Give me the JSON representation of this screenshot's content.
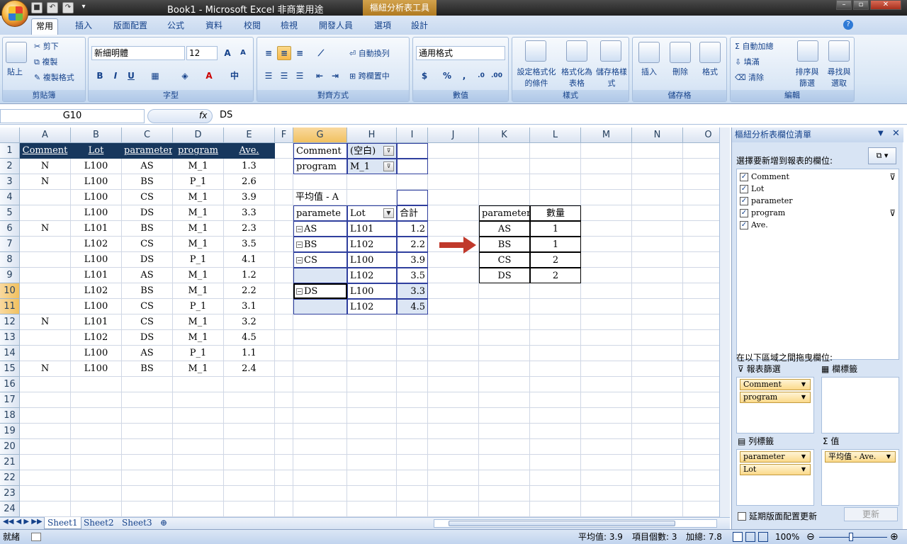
{
  "window": {
    "title": "Book1 - Microsoft Excel 非商業用途",
    "context_tab": "樞紐分析表工具"
  },
  "tabs": [
    "常用",
    "插入",
    "版面配置",
    "公式",
    "資料",
    "校閱",
    "檢視",
    "開發人員",
    "選項",
    "設計"
  ],
  "ribbon": {
    "clipboard": {
      "paste": "貼上",
      "cut": "剪下",
      "copy": "複製",
      "format_painter": "複製格式",
      "label": "剪貼簿"
    },
    "font": {
      "name": "新細明體",
      "size": "12",
      "label": "字型"
    },
    "alignment": {
      "wrap": "自動換列",
      "merge": "跨欄置中",
      "label": "對齊方式"
    },
    "number": {
      "format": "通用格式",
      "label": "數值"
    },
    "styles": {
      "cond": "設定格式化的條件",
      "table": "格式化為表格",
      "cell": "儲存格樣式",
      "label": "樣式"
    },
    "cells": {
      "insert": "插入",
      "delete": "刪除",
      "format": "格式",
      "label": "儲存格"
    },
    "editing": {
      "autosum": "自動加總",
      "fill": "填滿",
      "clear": "清除",
      "sort": "排序與篩選",
      "find": "尋找與選取",
      "label": "編輯"
    }
  },
  "formula_bar": {
    "name_box": "G10",
    "fx": "fx",
    "content": "DS"
  },
  "columns": [
    "A",
    "B",
    "C",
    "D",
    "E",
    "F",
    "G",
    "H",
    "I",
    "J",
    "K",
    "L",
    "M",
    "N",
    "O"
  ],
  "rows": [
    "1",
    "2",
    "3",
    "4",
    "5",
    "6",
    "7",
    "8",
    "9",
    "10",
    "11",
    "12",
    "13",
    "14",
    "15",
    "16",
    "17",
    "18",
    "19",
    "20",
    "21",
    "22",
    "23",
    "24"
  ],
  "source_table": {
    "headers": [
      "Comment",
      "Lot",
      "parameter",
      "program",
      "Ave."
    ],
    "rows": [
      [
        "N",
        "L100",
        "AS",
        "M_1",
        "1.3"
      ],
      [
        "N",
        "L100",
        "BS",
        "P_1",
        "2.6"
      ],
      [
        "",
        "L100",
        "CS",
        "M_1",
        "3.9"
      ],
      [
        "",
        "L100",
        "DS",
        "M_1",
        "3.3"
      ],
      [
        "N",
        "L101",
        "BS",
        "M_1",
        "2.3"
      ],
      [
        "",
        "L102",
        "CS",
        "M_1",
        "3.5"
      ],
      [
        "",
        "L100",
        "DS",
        "P_1",
        "4.1"
      ],
      [
        "",
        "L101",
        "AS",
        "M_1",
        "1.2"
      ],
      [
        "",
        "L102",
        "BS",
        "M_1",
        "2.2"
      ],
      [
        "",
        "L100",
        "CS",
        "P_1",
        "3.1"
      ],
      [
        "N",
        "L101",
        "CS",
        "M_1",
        "3.2"
      ],
      [
        "",
        "L102",
        "DS",
        "M_1",
        "4.5"
      ],
      [
        "",
        "L100",
        "AS",
        "P_1",
        "1.1"
      ],
      [
        "N",
        "L100",
        "BS",
        "M_1",
        "2.4"
      ]
    ]
  },
  "pivot": {
    "filters": [
      [
        "Comment",
        "(空白)"
      ],
      [
        "program",
        "M_1"
      ]
    ],
    "data_label": "平均值 - A",
    "headers": [
      "paramete",
      "Lot",
      "合計"
    ],
    "rows": [
      [
        "AS",
        "L101",
        "1.2"
      ],
      [
        "BS",
        "L102",
        "2.2"
      ],
      [
        "CS",
        "L100",
        "3.9"
      ],
      [
        "",
        "L102",
        "3.5"
      ],
      [
        "DS",
        "L100",
        "3.3"
      ],
      [
        "",
        "L102",
        "4.5"
      ]
    ]
  },
  "result_table": {
    "headers": [
      "parameter",
      "數量"
    ],
    "rows": [
      [
        "AS",
        "1"
      ],
      [
        "BS",
        "1"
      ],
      [
        "CS",
        "2"
      ],
      [
        "DS",
        "2"
      ]
    ]
  },
  "sheets": [
    "Sheet1",
    "Sheet2",
    "Sheet3"
  ],
  "status": {
    "ready": "就緒",
    "average": "平均值: 3.9",
    "count": "項目個數: 3",
    "sum": "加總: 7.8",
    "zoom": "100%"
  },
  "pane": {
    "title": "樞紐分析表欄位清單",
    "choose": "選擇要新增到報表的欄位:",
    "fields": [
      "Comment",
      "Lot",
      "parameter",
      "program",
      "Ave."
    ],
    "drag_label": "在以下區域之間拖曳欄位:",
    "report_filter": "報表篩選",
    "column_labels": "欄標籤",
    "row_labels": "列標籤",
    "values": "值",
    "filter_items": [
      "Comment",
      "program"
    ],
    "row_items": [
      "parameter",
      "Lot"
    ],
    "value_items": [
      "平均值 - Ave."
    ],
    "defer": "延期版面配置更新",
    "update": "更新"
  },
  "colors": {
    "header_bg": "#17375d",
    "arrow": "#c0392b",
    "selection": "#f1c15f"
  }
}
